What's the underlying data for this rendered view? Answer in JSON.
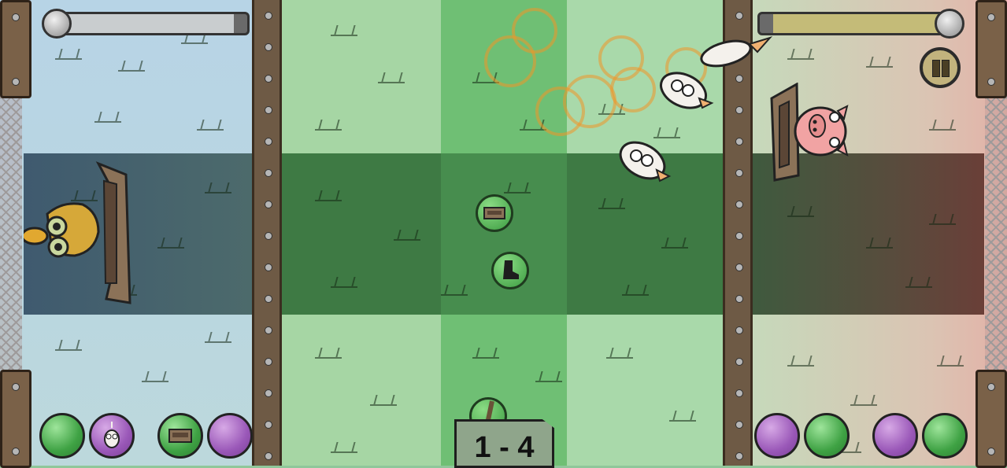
{
  "hud": {
    "score": "1 - 4",
    "left_health": 0.93,
    "right_health": 0.93,
    "pause_icon": "pause-icon"
  },
  "players": {
    "left": {
      "character": "yellow-bird",
      "powerups": [
        {
          "color": "green",
          "icon": ""
        },
        {
          "color": "purple",
          "icon": "owl-icon"
        },
        {
          "color": "green",
          "icon": "trap-icon"
        },
        {
          "color": "purple",
          "icon": ""
        }
      ]
    },
    "right": {
      "character": "pink-pig",
      "powerups": [
        {
          "color": "purple",
          "icon": ""
        },
        {
          "color": "green",
          "icon": ""
        },
        {
          "color": "purple",
          "icon": ""
        },
        {
          "color": "green",
          "icon": ""
        }
      ]
    }
  },
  "field_items": [
    "trap-icon",
    "boot-icon",
    "stick-icon"
  ],
  "colors": {
    "green_orb": "#3fa244",
    "purple_orb": "#9a58b8",
    "band": "#3e7a44",
    "wall": "#6e5a45"
  }
}
